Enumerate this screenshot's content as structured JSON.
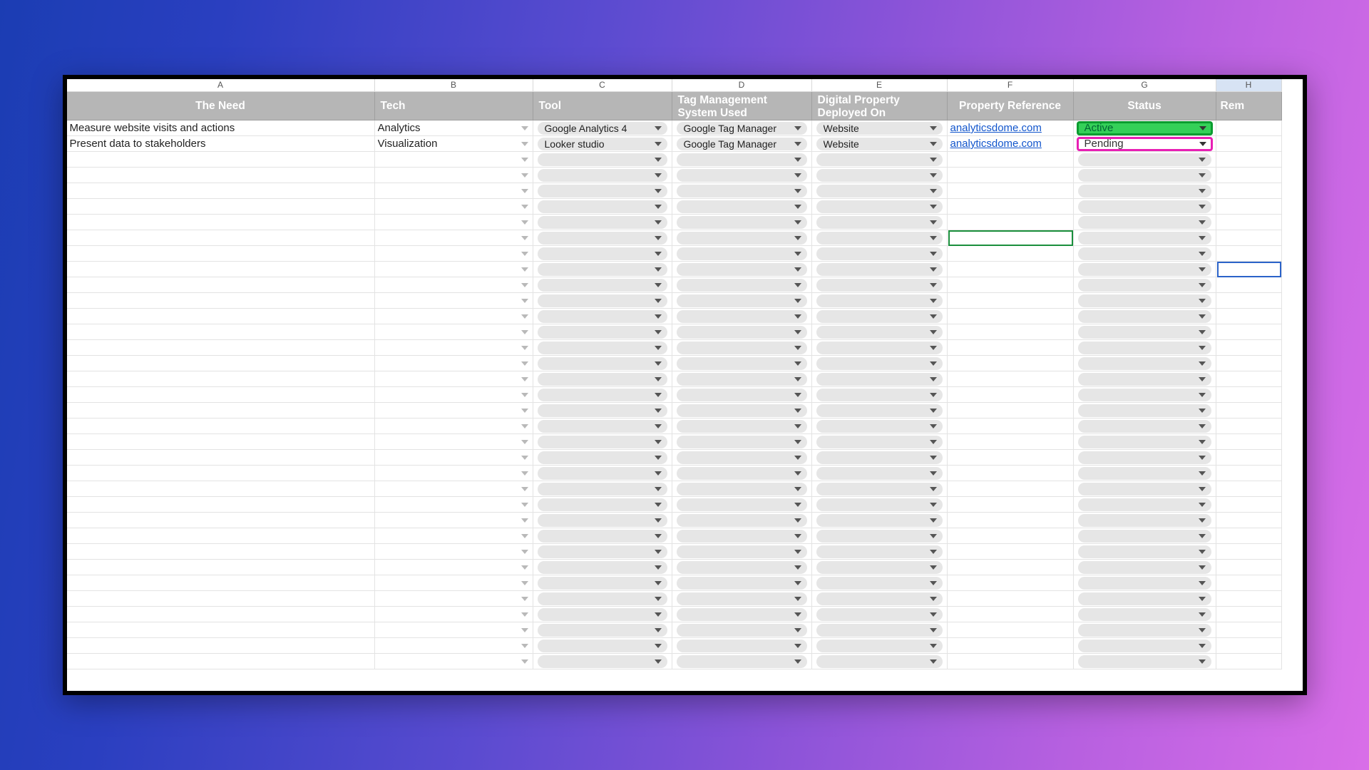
{
  "columns": [
    {
      "letter": "A",
      "label": "The Need"
    },
    {
      "letter": "B",
      "label": "Tech"
    },
    {
      "letter": "C",
      "label": "Tool"
    },
    {
      "letter": "D",
      "label": "Tag Management System Used"
    },
    {
      "letter": "E",
      "label": "Digital Property Deployed On"
    },
    {
      "letter": "F",
      "label": "Property Reference"
    },
    {
      "letter": "G",
      "label": "Status"
    },
    {
      "letter": "H",
      "label": "Rem"
    }
  ],
  "rows": [
    {
      "need": "Measure website visits and actions",
      "tech": "Analytics",
      "tool": "Google Analytics 4",
      "tms": "Google Tag Manager",
      "property": "Website",
      "ref": "analyticsdome.com",
      "status": "Active",
      "status_kind": "active"
    },
    {
      "need": "Present data to stakeholders",
      "tech": "Visualization",
      "tool": "Looker studio",
      "tms": "Google Tag Manager",
      "property": "Website",
      "ref": "analyticsdome.com",
      "status": "Pending",
      "status_kind": "pending"
    }
  ],
  "empty_row_count": 33,
  "selected_column_index": 7,
  "green_selection_row": 7,
  "blue_selection_row": 9
}
